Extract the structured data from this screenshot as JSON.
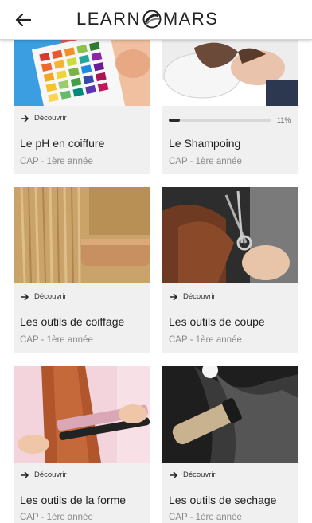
{
  "header": {
    "brand_left": "LEARN",
    "brand_right": "MARS",
    "logo_icon": "globe-logo-icon",
    "back_icon": "arrow-left-icon"
  },
  "cards": [
    {
      "title": "Le pH en coiffure",
      "level": "CAP - 1ère année",
      "action": "Découvrir",
      "image": "ph-strips-photo"
    },
    {
      "title": "Le Shampoing",
      "level": "CAP - 1ère année",
      "progress_label": "11%",
      "progress": 0.11,
      "image": "shampoo-photo"
    },
    {
      "title": "Les outils de coiffage",
      "level": "CAP - 1ère année",
      "action": "Découvrir",
      "image": "comb-hair-photo"
    },
    {
      "title": "Les outils de coupe",
      "level": "CAP - 1ère année",
      "action": "Découvrir",
      "image": "scissors-photo"
    },
    {
      "title": "Les outils de la forme",
      "level": "CAP - 1ère année",
      "action": "Découvrir",
      "image": "straightener-photo"
    },
    {
      "title": "Les outils de sechage",
      "level": "CAP - 1ère année",
      "action": "Découvrir",
      "image": "hairdryer-photo"
    }
  ],
  "colors": {
    "card_bg": "#f0f0f0",
    "progress_fill": "#2a2a2a",
    "progress_track": "#d8d8d8"
  }
}
